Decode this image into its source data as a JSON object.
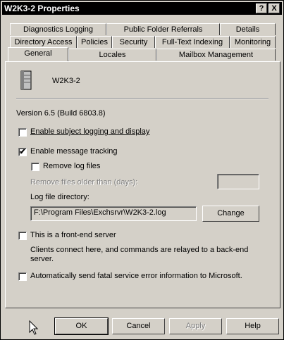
{
  "window": {
    "title": "W2K3-2 Properties",
    "help_button": "?",
    "close_button": "X"
  },
  "tabs": {
    "row1": [
      "Diagnostics Logging",
      "Public Folder Referrals",
      "Details"
    ],
    "row2": [
      "Directory Access",
      "Policies",
      "Security",
      "Full-Text Indexing",
      "Monitoring"
    ],
    "row3": [
      "General",
      "Locales",
      "Mailbox Management"
    ],
    "active": "General"
  },
  "general": {
    "server_name": "W2K3-2",
    "version": "Version 6.5 (Build 6803.8)",
    "enable_subject_logging": {
      "label": "Enable subject logging and display",
      "checked": false
    },
    "enable_message_tracking": {
      "label": "Enable message tracking",
      "checked": true
    },
    "remove_log_files": {
      "label": "Remove log files",
      "checked": false
    },
    "remove_older_than_label": "Remove files older than (days):",
    "remove_older_than_value": "",
    "log_dir_label": "Log file directory:",
    "log_dir_value": "F:\\Program Files\\Exchsrvr\\W2K3-2.log",
    "change_button": "Change",
    "front_end": {
      "label": "This is a front-end server",
      "checked": false
    },
    "front_end_desc": "Clients connect here, and commands are relayed to a back-end server.",
    "auto_send_errors": {
      "label": "Automatically send fatal service error information to Microsoft.",
      "checked": false
    }
  },
  "buttons": {
    "ok": "OK",
    "cancel": "Cancel",
    "apply": "Apply",
    "help": "Help"
  },
  "icons": {
    "server": "server-icon",
    "cursor": "mouse-cursor-icon",
    "checkmark": "✔"
  }
}
